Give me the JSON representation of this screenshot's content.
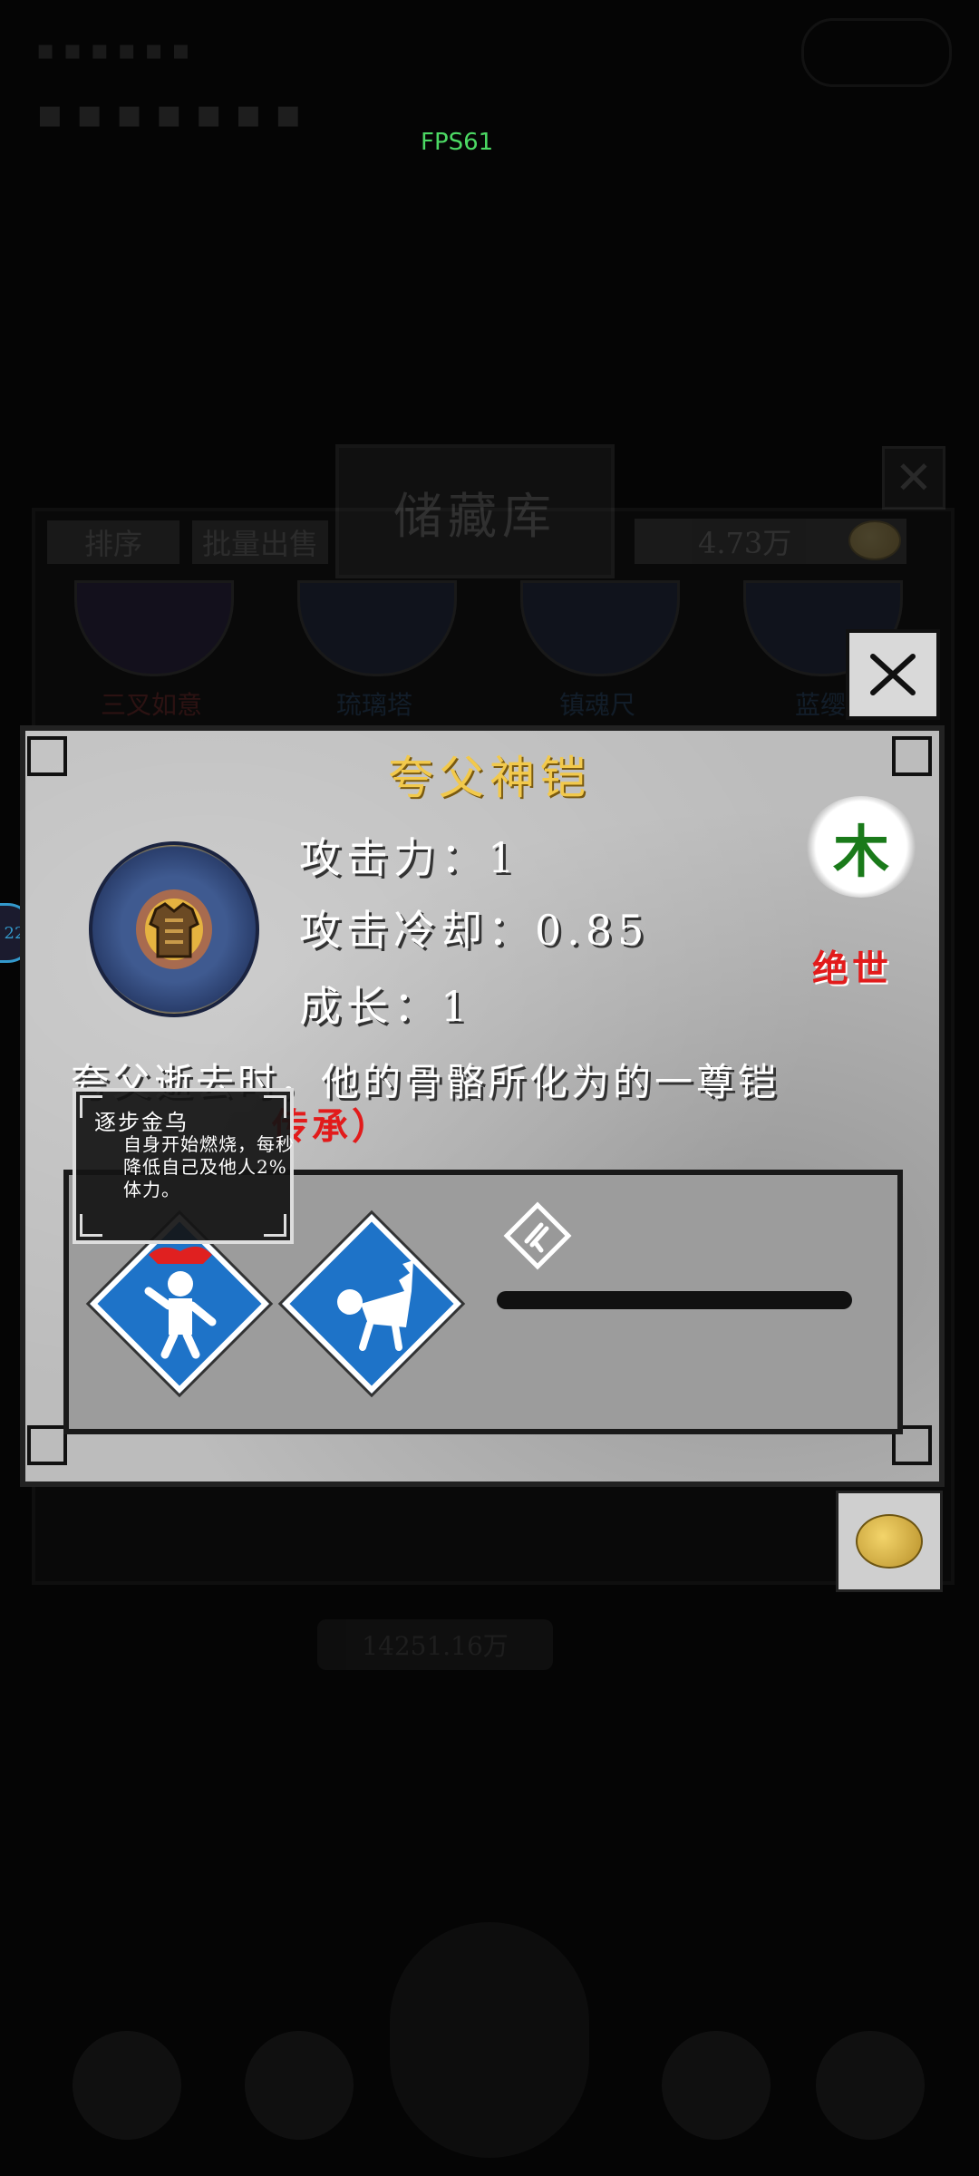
{
  "hud": {
    "fps": "FPS61"
  },
  "storage": {
    "title": "储藏库",
    "sort_label": "排序",
    "batch_sell_label": "批量出售",
    "coins": "4.73万",
    "items": [
      "三叉如意",
      "琉璃塔",
      "镇魂尺",
      "蓝缨"
    ],
    "bottom_value": "14251.16万"
  },
  "item": {
    "name": "夸父神铠",
    "attack_label": "攻击力：1",
    "cooldown_label": "攻击冷却：0.85",
    "growth_label": "成长：1",
    "element": "木",
    "rarity": "绝世",
    "description": "夸父逝去时，他的骨骼所化为的一尊铠",
    "inherit_tag": "传承）"
  },
  "tooltip": {
    "title": "逐步金乌",
    "body": "自身开始燃烧，每秒降低自己及他人2%体力。"
  },
  "colors": {
    "item_name": "#f2c94c",
    "rarity": "#e21b1b",
    "element": "#1a7a1a",
    "skill_blue": "#1e73c8",
    "fps": "#4cd964"
  }
}
